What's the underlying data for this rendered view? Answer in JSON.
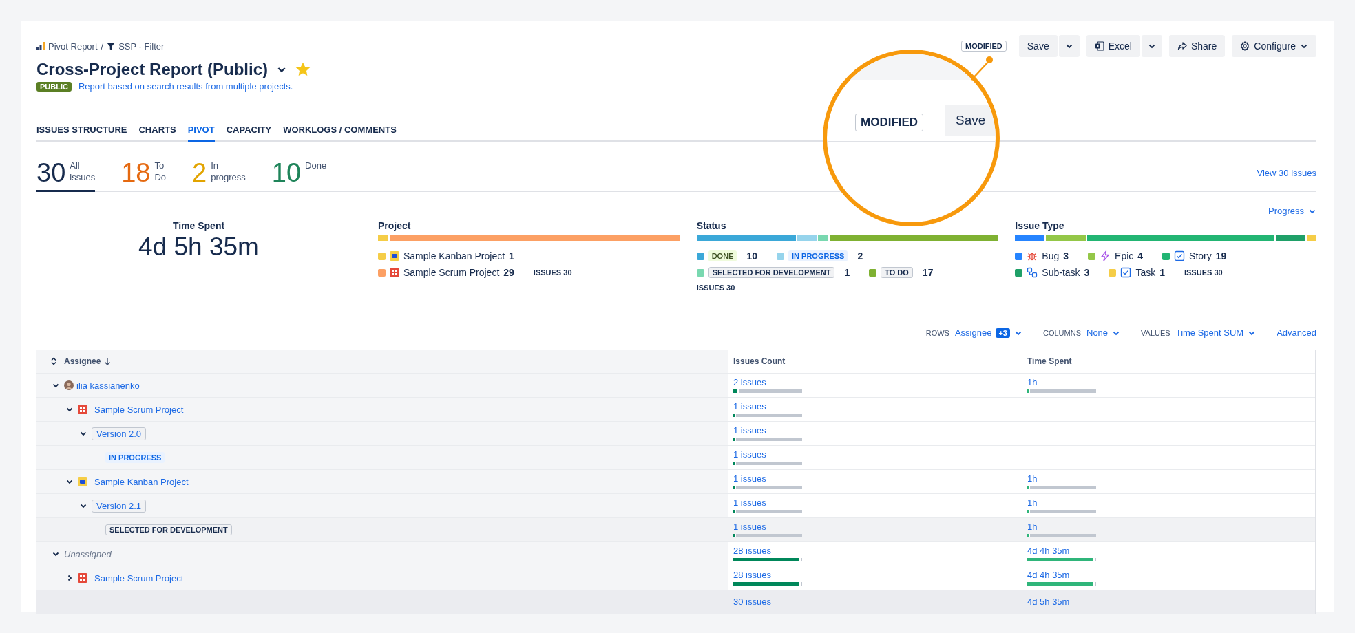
{
  "breadcrumb": {
    "separator": "/",
    "items": [
      {
        "kind": "report",
        "label": "Pivot Report"
      },
      {
        "kind": "filter",
        "label": "SSP - Filter"
      }
    ]
  },
  "report": {
    "title": "Cross-Project Report (Public)",
    "starred": true,
    "visibility": "PUBLIC",
    "description": "Report based on search results from multiple projects."
  },
  "status_badge": "MODIFIED",
  "toolbar": [
    {
      "kind": "split",
      "label": "Save"
    },
    {
      "kind": "excel-split",
      "label": "Excel"
    },
    {
      "kind": "share",
      "label": "Share"
    },
    {
      "kind": "configure",
      "label": "Configure"
    }
  ],
  "tabs": [
    {
      "label": "ISSUES STRUCTURE",
      "selected": false
    },
    {
      "label": "CHARTS",
      "selected": false
    },
    {
      "label": "PIVOT",
      "selected": true
    },
    {
      "label": "CAPACITY",
      "selected": false
    },
    {
      "label": "WORKLOGS / COMMENTS",
      "selected": false
    }
  ],
  "summary": [
    {
      "value": "30",
      "label": "All issues",
      "color": "#172b4d",
      "selected": true
    },
    {
      "value": "18",
      "label": "To Do",
      "color": "#e56910",
      "selected": false
    },
    {
      "value": "2",
      "label": "In progress",
      "color": "#e2a400",
      "selected": false
    },
    {
      "value": "10",
      "label": "Done",
      "color": "#1f845a",
      "selected": false
    }
  ],
  "view_link": "View 30 issues",
  "progress_menu": "Progress",
  "time_spent": {
    "label": "Time Spent",
    "value": "4d 5h 35m"
  },
  "project": {
    "title": "Project",
    "total_label": "ISSUES",
    "total": "30",
    "items": [
      {
        "kind": "kanban",
        "name": "Sample Kanban Project",
        "count": "1",
        "color": "#f5cd47"
      },
      {
        "kind": "scrum",
        "name": "Sample Scrum Project",
        "count": "29",
        "color": "#fca064"
      }
    ]
  },
  "status": {
    "title": "Status",
    "total_label": "ISSUES",
    "total": "30",
    "items": [
      {
        "kind": "done",
        "label": "DONE",
        "count": "10",
        "color": "#3ba8d8"
      },
      {
        "kind": "inprogress",
        "label": "IN PROGRESS",
        "count": "2",
        "color": "#96d4ec"
      },
      {
        "kind": "neutral",
        "label": "SELECTED FOR DEVELOPMENT",
        "count": "1",
        "color": "#79d8b0"
      },
      {
        "kind": "neutral",
        "label": "TO DO",
        "count": "17",
        "color": "#7fb132"
      }
    ]
  },
  "issue_type": {
    "title": "Issue Type",
    "total_label": "ISSUES",
    "total": "30",
    "items": [
      {
        "kind": "bug",
        "name": "Bug",
        "count": "3",
        "color": "#2684ff"
      },
      {
        "kind": "epic",
        "name": "Epic",
        "count": "4",
        "color": "#94c748"
      },
      {
        "kind": "story",
        "name": "Story",
        "count": "19",
        "color": "#22b573"
      },
      {
        "kind": "subtask",
        "name": "Sub-task",
        "count": "3",
        "color": "#1fa068"
      },
      {
        "kind": "task",
        "name": "Task",
        "count": "1",
        "color": "#f5cd47"
      }
    ]
  },
  "pivot_controls": [
    {
      "label": "ROWS",
      "value": "Assignee",
      "badge": "+3"
    },
    {
      "label": "COLUMNS",
      "value": "None"
    },
    {
      "label": "VALUES",
      "value": "Time Spent SUM"
    }
  ],
  "advanced_link": "Advanced",
  "table": {
    "columns": [
      "Assignee",
      "Issues Count",
      "Time Spent"
    ],
    "rows": [
      {
        "kind": "assignee",
        "label": "ilia kassianenko",
        "expanded": true,
        "highlighted": false,
        "issues": {
          "text": "2 issues",
          "level": 0.08
        },
        "time": {
          "text": "1h",
          "level": 0.04
        },
        "children": [
          {
            "kind": "scrum-project",
            "label": "Sample Scrum Project",
            "expanded": true,
            "highlighted": false,
            "issues": {
              "text": "1 issues",
              "level": 0.04
            },
            "children": [
              {
                "kind": "version",
                "label": "Version 2.0",
                "expanded": true,
                "highlighted": false,
                "issues": {
                  "text": "1 issues",
                  "level": 0.04
                },
                "children": [
                  {
                    "kind": "status-inprogress",
                    "label": "IN PROGRESS",
                    "highlighted": false,
                    "issues": {
                      "text": "1 issues",
                      "level": 0.04
                    }
                  }
                ]
              }
            ]
          },
          {
            "kind": "kanban-project",
            "label": "Sample Kanban Project",
            "expanded": true,
            "highlighted": false,
            "issues": {
              "text": "1 issues",
              "level": 0.04
            },
            "time": {
              "text": "1h",
              "level": 0.04
            },
            "children": [
              {
                "kind": "version",
                "label": "Version 2.1",
                "expanded": true,
                "highlighted": false,
                "issues": {
                  "text": "1 issues",
                  "level": 0.04
                },
                "time": {
                  "text": "1h",
                  "level": 0.04
                },
                "children": [
                  {
                    "kind": "status-neutral",
                    "label": "SELECTED FOR DEVELOPMENT",
                    "highlighted": true,
                    "issues": {
                      "text": "1 issues",
                      "level": 0.04
                    },
                    "time": {
                      "text": "1h",
                      "level": 0.04
                    }
                  }
                ]
              }
            ]
          }
        ]
      },
      {
        "kind": "none",
        "label": "Unassigned",
        "expanded": true,
        "highlighted": false,
        "issues": {
          "text": "28 issues",
          "level": 1
        },
        "time": {
          "text": "4d 4h 35m",
          "level": 1
        },
        "children": [
          {
            "kind": "scrum-project",
            "label": "Sample Scrum Project",
            "expanded": false,
            "highlighted": false,
            "issues": {
              "text": "28 issues",
              "level": 1
            },
            "time": {
              "text": "4d 4h 35m",
              "level": 1
            }
          }
        ]
      }
    ],
    "total": {
      "issues": "30 issues",
      "time": "4d 5h 35m"
    }
  },
  "magnifier": {
    "badge": "MODIFIED",
    "button": "Save"
  }
}
